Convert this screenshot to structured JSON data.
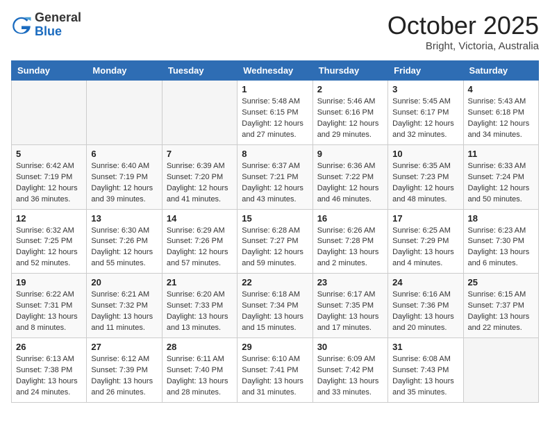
{
  "header": {
    "logo_line1": "General",
    "logo_line2": "Blue",
    "month": "October 2025",
    "location": "Bright, Victoria, Australia"
  },
  "weekdays": [
    "Sunday",
    "Monday",
    "Tuesday",
    "Wednesday",
    "Thursday",
    "Friday",
    "Saturday"
  ],
  "weeks": [
    [
      {
        "day": "",
        "info": ""
      },
      {
        "day": "",
        "info": ""
      },
      {
        "day": "",
        "info": ""
      },
      {
        "day": "1",
        "info": "Sunrise: 5:48 AM\nSunset: 6:15 PM\nDaylight: 12 hours\nand 27 minutes."
      },
      {
        "day": "2",
        "info": "Sunrise: 5:46 AM\nSunset: 6:16 PM\nDaylight: 12 hours\nand 29 minutes."
      },
      {
        "day": "3",
        "info": "Sunrise: 5:45 AM\nSunset: 6:17 PM\nDaylight: 12 hours\nand 32 minutes."
      },
      {
        "day": "4",
        "info": "Sunrise: 5:43 AM\nSunset: 6:18 PM\nDaylight: 12 hours\nand 34 minutes."
      }
    ],
    [
      {
        "day": "5",
        "info": "Sunrise: 6:42 AM\nSunset: 7:19 PM\nDaylight: 12 hours\nand 36 minutes."
      },
      {
        "day": "6",
        "info": "Sunrise: 6:40 AM\nSunset: 7:19 PM\nDaylight: 12 hours\nand 39 minutes."
      },
      {
        "day": "7",
        "info": "Sunrise: 6:39 AM\nSunset: 7:20 PM\nDaylight: 12 hours\nand 41 minutes."
      },
      {
        "day": "8",
        "info": "Sunrise: 6:37 AM\nSunset: 7:21 PM\nDaylight: 12 hours\nand 43 minutes."
      },
      {
        "day": "9",
        "info": "Sunrise: 6:36 AM\nSunset: 7:22 PM\nDaylight: 12 hours\nand 46 minutes."
      },
      {
        "day": "10",
        "info": "Sunrise: 6:35 AM\nSunset: 7:23 PM\nDaylight: 12 hours\nand 48 minutes."
      },
      {
        "day": "11",
        "info": "Sunrise: 6:33 AM\nSunset: 7:24 PM\nDaylight: 12 hours\nand 50 minutes."
      }
    ],
    [
      {
        "day": "12",
        "info": "Sunrise: 6:32 AM\nSunset: 7:25 PM\nDaylight: 12 hours\nand 52 minutes."
      },
      {
        "day": "13",
        "info": "Sunrise: 6:30 AM\nSunset: 7:26 PM\nDaylight: 12 hours\nand 55 minutes."
      },
      {
        "day": "14",
        "info": "Sunrise: 6:29 AM\nSunset: 7:26 PM\nDaylight: 12 hours\nand 57 minutes."
      },
      {
        "day": "15",
        "info": "Sunrise: 6:28 AM\nSunset: 7:27 PM\nDaylight: 12 hours\nand 59 minutes."
      },
      {
        "day": "16",
        "info": "Sunrise: 6:26 AM\nSunset: 7:28 PM\nDaylight: 13 hours\nand 2 minutes."
      },
      {
        "day": "17",
        "info": "Sunrise: 6:25 AM\nSunset: 7:29 PM\nDaylight: 13 hours\nand 4 minutes."
      },
      {
        "day": "18",
        "info": "Sunrise: 6:23 AM\nSunset: 7:30 PM\nDaylight: 13 hours\nand 6 minutes."
      }
    ],
    [
      {
        "day": "19",
        "info": "Sunrise: 6:22 AM\nSunset: 7:31 PM\nDaylight: 13 hours\nand 8 minutes."
      },
      {
        "day": "20",
        "info": "Sunrise: 6:21 AM\nSunset: 7:32 PM\nDaylight: 13 hours\nand 11 minutes."
      },
      {
        "day": "21",
        "info": "Sunrise: 6:20 AM\nSunset: 7:33 PM\nDaylight: 13 hours\nand 13 minutes."
      },
      {
        "day": "22",
        "info": "Sunrise: 6:18 AM\nSunset: 7:34 PM\nDaylight: 13 hours\nand 15 minutes."
      },
      {
        "day": "23",
        "info": "Sunrise: 6:17 AM\nSunset: 7:35 PM\nDaylight: 13 hours\nand 17 minutes."
      },
      {
        "day": "24",
        "info": "Sunrise: 6:16 AM\nSunset: 7:36 PM\nDaylight: 13 hours\nand 20 minutes."
      },
      {
        "day": "25",
        "info": "Sunrise: 6:15 AM\nSunset: 7:37 PM\nDaylight: 13 hours\nand 22 minutes."
      }
    ],
    [
      {
        "day": "26",
        "info": "Sunrise: 6:13 AM\nSunset: 7:38 PM\nDaylight: 13 hours\nand 24 minutes."
      },
      {
        "day": "27",
        "info": "Sunrise: 6:12 AM\nSunset: 7:39 PM\nDaylight: 13 hours\nand 26 minutes."
      },
      {
        "day": "28",
        "info": "Sunrise: 6:11 AM\nSunset: 7:40 PM\nDaylight: 13 hours\nand 28 minutes."
      },
      {
        "day": "29",
        "info": "Sunrise: 6:10 AM\nSunset: 7:41 PM\nDaylight: 13 hours\nand 31 minutes."
      },
      {
        "day": "30",
        "info": "Sunrise: 6:09 AM\nSunset: 7:42 PM\nDaylight: 13 hours\nand 33 minutes."
      },
      {
        "day": "31",
        "info": "Sunrise: 6:08 AM\nSunset: 7:43 PM\nDaylight: 13 hours\nand 35 minutes."
      },
      {
        "day": "",
        "info": ""
      }
    ]
  ]
}
